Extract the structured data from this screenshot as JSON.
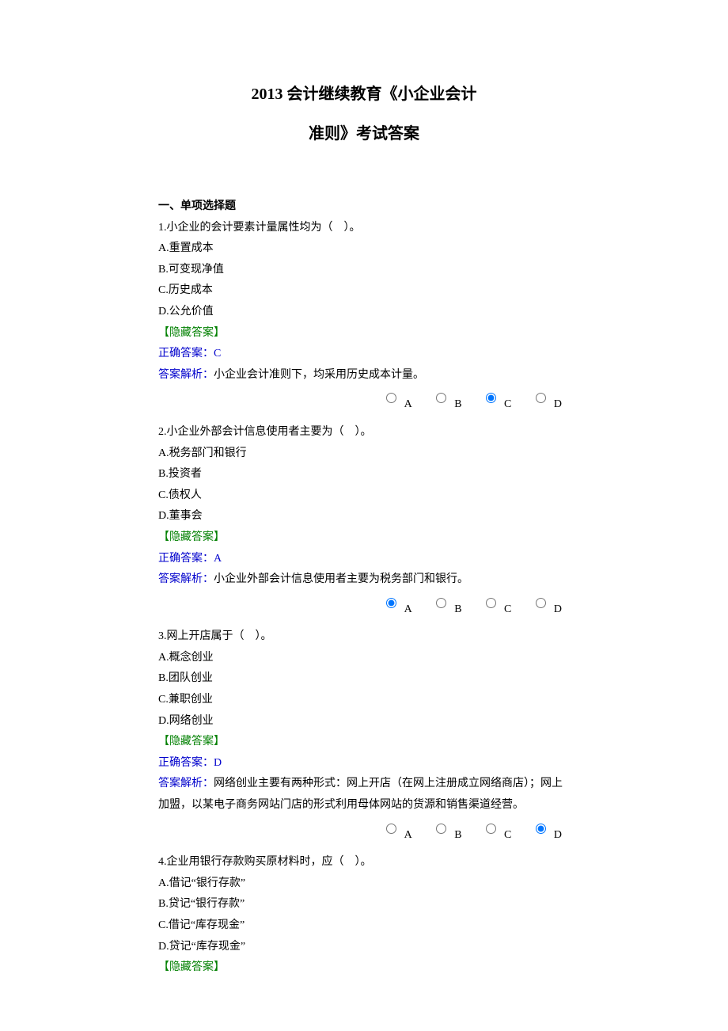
{
  "title": {
    "line1": "2013 会计继续教育《小企业会计",
    "line2": "准则》考试答案"
  },
  "section_header": "一、单项选择题",
  "hide_answer_label": "【隐藏答案】",
  "correct_answer_label": "正确答案：",
  "analysis_label": "答案解析：",
  "radio_options": [
    "A",
    "B",
    "C",
    "D"
  ],
  "questions": [
    {
      "stem": "1.小企业的会计要素计量属性均为（　）。",
      "options": [
        "A.重置成本",
        "B.可变现净值",
        "C.历史成本",
        "D.公允价值"
      ],
      "correct": "C",
      "analysis": "小企业会计准则下，均采用历史成本计量。",
      "selected": "C"
    },
    {
      "stem": "2.小企业外部会计信息使用者主要为（　）。",
      "options": [
        "A.税务部门和银行",
        "B.投资者",
        "C.债权人",
        "D.董事会"
      ],
      "correct": "A",
      "analysis": "小企业外部会计信息使用者主要为税务部门和银行。",
      "selected": "A"
    },
    {
      "stem": "3.网上开店属于（　）。",
      "options": [
        "A.概念创业",
        "B.团队创业",
        "C.兼职创业",
        "D.网络创业"
      ],
      "correct": "D",
      "analysis": "网络创业主要有两种形式：网上开店（在网上注册成立网络商店）；网上加盟，以某电子商务网站门店的形式利用母体网站的货源和销售渠道经营。",
      "selected": "D"
    },
    {
      "stem": "4.企业用银行存款购买原材料时，应（　）。",
      "options": [
        "A.借记“银行存款”",
        "B.贷记“银行存款”",
        "C.借记“库存现金”",
        "D.贷记“库存现金”"
      ],
      "correct": "",
      "analysis": "",
      "selected": ""
    }
  ]
}
